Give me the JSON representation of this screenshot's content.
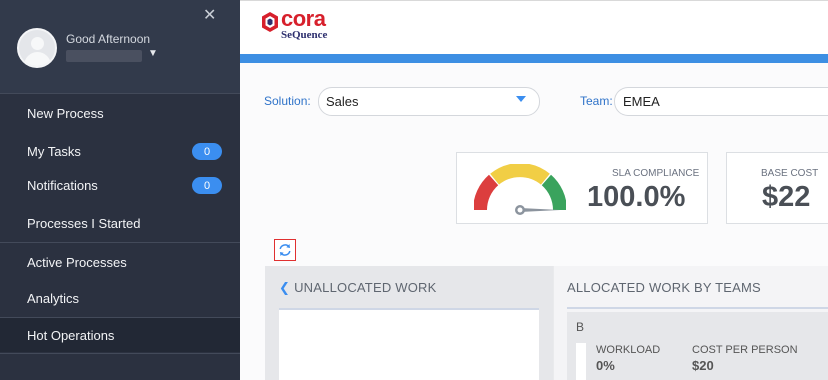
{
  "sidebar": {
    "greeting": "Good Afternoon",
    "nav": [
      {
        "label": "New Process"
      },
      {
        "label": "My Tasks",
        "badge": "0"
      },
      {
        "label": "Notifications",
        "badge": "0"
      },
      {
        "label": "Processes I Started"
      },
      {
        "label": "Active Processes"
      },
      {
        "label": "Analytics"
      },
      {
        "label": "Hot Operations"
      }
    ]
  },
  "brand": {
    "name": "cora",
    "product": "SeQuence",
    "red": "#d7202c",
    "navy": "#2d2f6e",
    "accent": "#3d8fe3"
  },
  "filters": {
    "solution_label": "Solution:",
    "solution_value": "Sales",
    "team_label": "Team:",
    "team_value": "EMEA"
  },
  "kpis": {
    "sla_label": "SLA COMPLIANCE",
    "sla_value": "100.0%",
    "sla_gauge_fraction": 1.0,
    "cost_label": "BASE COST",
    "cost_value": "$22"
  },
  "panels": {
    "unallocated_title": "UNALLOCATED WORK",
    "allocated_title": "ALLOCATED WORK BY TEAMS",
    "team": {
      "name": "B",
      "workload_label": "WORKLOAD",
      "workload_value": "0%",
      "cost_label": "COST PER PERSON",
      "cost_value": "$20"
    }
  },
  "icons": [
    "close-icon",
    "user-avatar-icon",
    "chevron-down-icon",
    "refresh-icon",
    "chevron-left-icon",
    "gauge-icon",
    "cora-logo-icon"
  ]
}
